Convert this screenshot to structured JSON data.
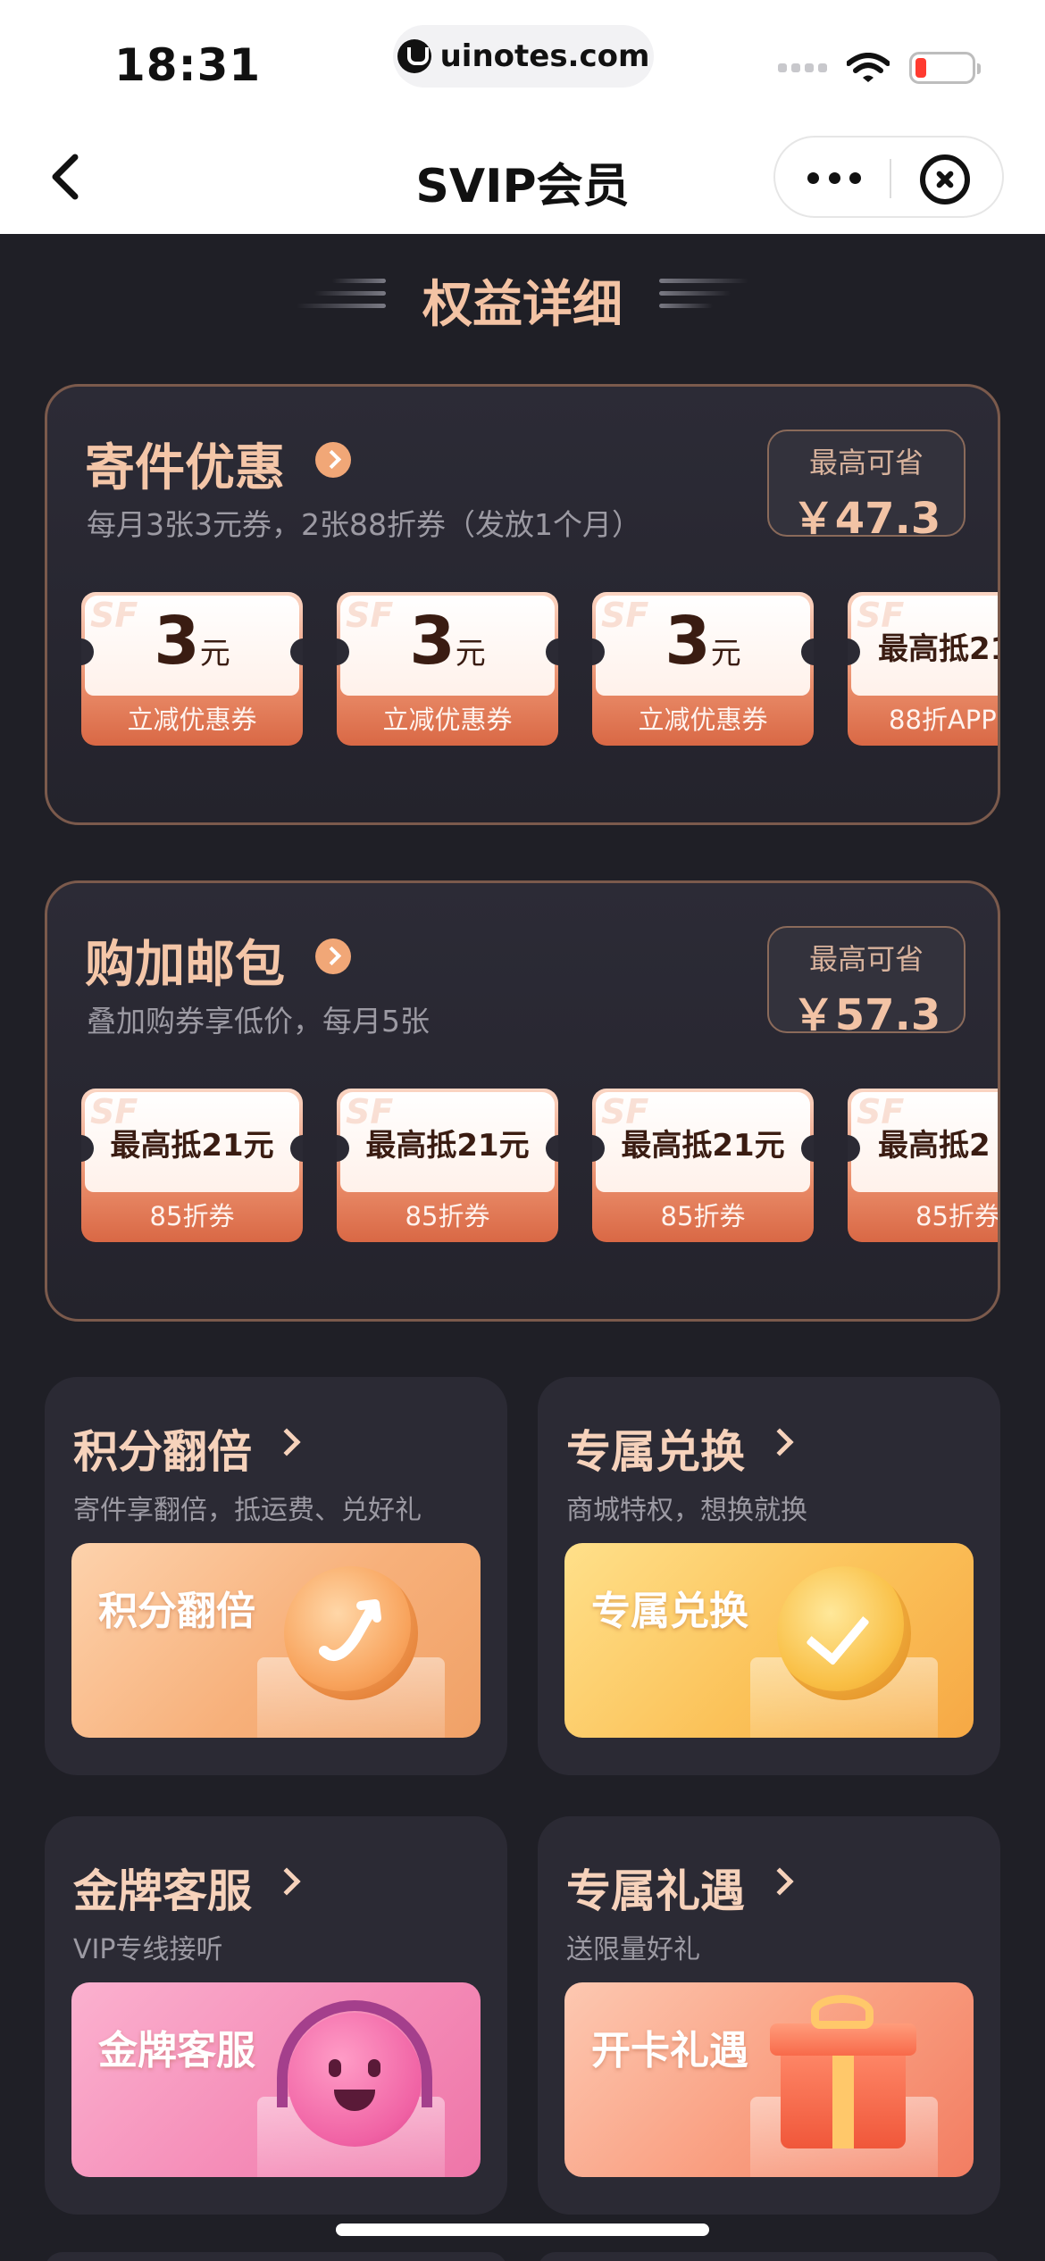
{
  "status_bar": {
    "time": "18:31",
    "url": "uinotes.com"
  },
  "nav": {
    "title": "SVIP会员"
  },
  "section_title": "权益详细",
  "cards": [
    {
      "title": "寄件优惠",
      "subtitle": "每月3张3元券，2张88折券（发放1个月）",
      "save_label": "最高可省",
      "save_value": "￥47.3",
      "coupons": [
        {
          "amount": "3",
          "unit": "元",
          "label": "立减优惠券"
        },
        {
          "amount": "3",
          "unit": "元",
          "label": "立减优惠券"
        },
        {
          "amount": "3",
          "unit": "元",
          "label": "立减优惠券"
        },
        {
          "text": "最高抵21",
          "label": "88折APP"
        }
      ]
    },
    {
      "title": "购加邮包",
      "subtitle": "叠加购券享低价，每月5张",
      "save_label": "最高可省",
      "save_value": "￥57.3",
      "coupons": [
        {
          "text": "最高抵21元",
          "label": "85折券"
        },
        {
          "text": "最高抵21元",
          "label": "85折券"
        },
        {
          "text": "最高抵21元",
          "label": "85折券"
        },
        {
          "text": "最高抵2",
          "label": "85折券"
        }
      ]
    }
  ],
  "benefits": [
    {
      "title": "积分翻倍",
      "subtitle": "寄件享翻倍，抵运费、兑好礼",
      "banner": "积分翻倍",
      "icon": "coin-arrow-icon"
    },
    {
      "title": "专属兑换",
      "subtitle": "商城特权，想换就换",
      "banner": "专属兑换",
      "icon": "coin-check-icon"
    },
    {
      "title": "金牌客服",
      "subtitle": "VIP专线接听",
      "banner": "金牌客服",
      "icon": "headset-smiley-icon"
    },
    {
      "title": "专属礼遇",
      "subtitle": "送限量好礼",
      "banner": "开卡礼遇",
      "icon": "gift-box-icon"
    }
  ]
}
